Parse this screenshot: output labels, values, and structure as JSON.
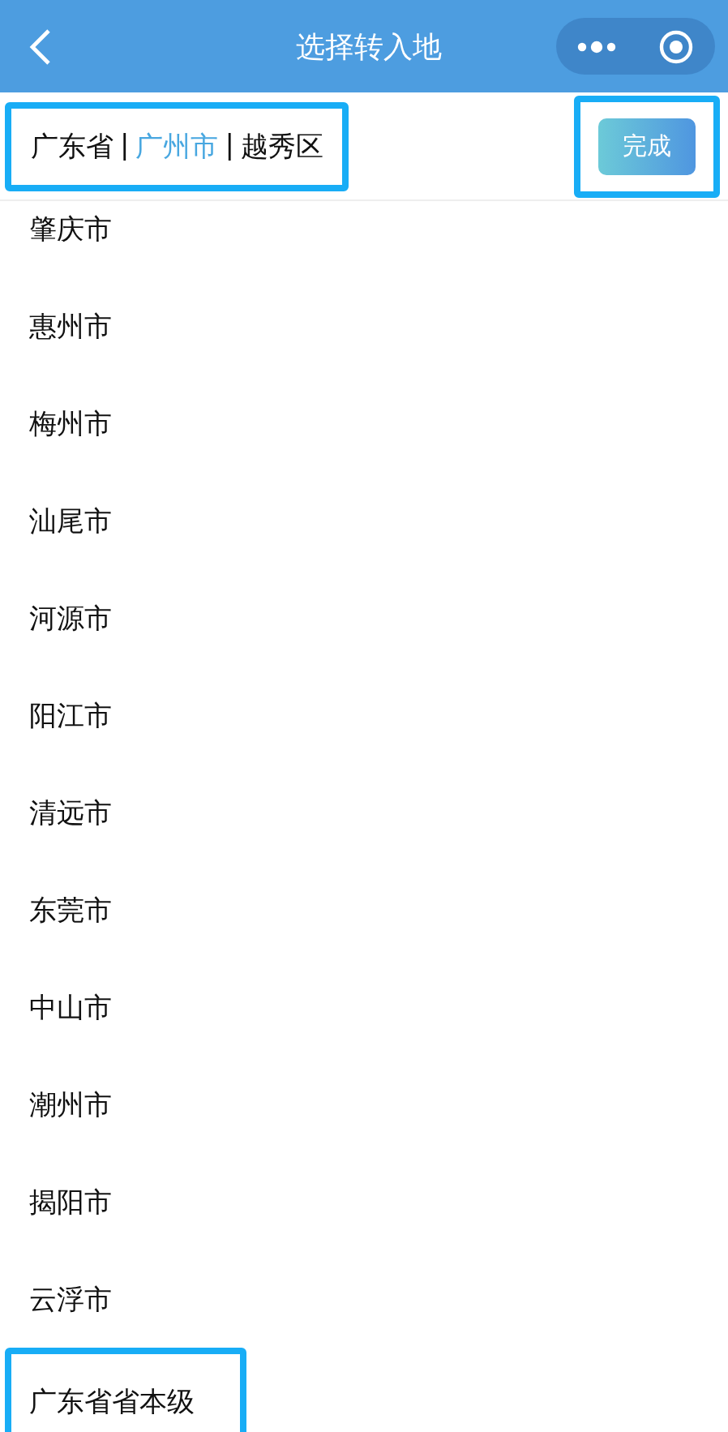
{
  "nav_bar": {
    "title": "选择转入地"
  },
  "breadcrumb": {
    "highlighted": true,
    "separator": "|",
    "items": [
      {
        "label": "广东省",
        "selected": false
      },
      {
        "label": "广州市",
        "selected": true
      },
      {
        "label": "越秀区",
        "selected": false
      }
    ]
  },
  "done_button": {
    "label": "完成",
    "highlighted": true
  },
  "cities": [
    {
      "label": "肇庆市",
      "highlighted": false
    },
    {
      "label": "惠州市",
      "highlighted": false
    },
    {
      "label": "梅州市",
      "highlighted": false
    },
    {
      "label": "汕尾市",
      "highlighted": false
    },
    {
      "label": "河源市",
      "highlighted": false
    },
    {
      "label": "阳江市",
      "highlighted": false
    },
    {
      "label": "清远市",
      "highlighted": false
    },
    {
      "label": "东莞市",
      "highlighted": false
    },
    {
      "label": "中山市",
      "highlighted": false
    },
    {
      "label": "潮州市",
      "highlighted": false
    },
    {
      "label": "揭阳市",
      "highlighted": false
    },
    {
      "label": "云浮市",
      "highlighted": false
    },
    {
      "label": "广东省省本级",
      "highlighted": true
    }
  ]
}
